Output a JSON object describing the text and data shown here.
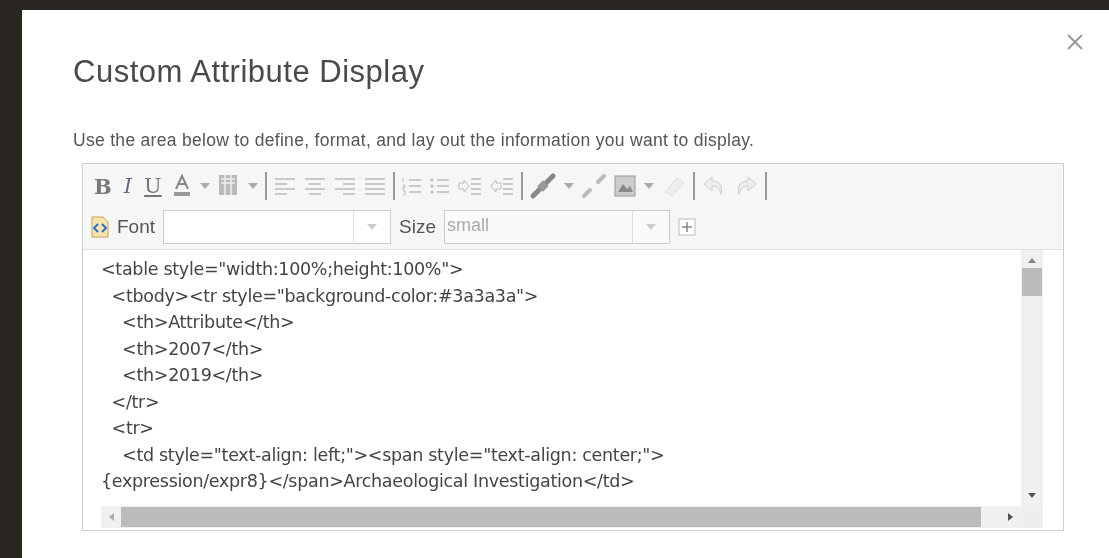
{
  "dialog": {
    "title": "Custom Attribute Display",
    "description": "Use the area below to define, format, and lay out the information you want to display."
  },
  "toolbar": {
    "text_buttons": [
      "B",
      "I",
      "U"
    ]
  },
  "font_row": {
    "font_label": "Font",
    "size_label": "Size",
    "size_value": "small"
  },
  "editor": {
    "lines": [
      "<table style=\"width:100%;height:100%\">",
      "  <tbody><tr style=\"background-color:#3a3a3a\">",
      "    <th>Attribute</th>",
      "    <th>2007</th>",
      "    <th>2019</th>",
      "  </tr>",
      "  <tr>",
      "    <td style=\"text-align: left;\"><span style=\"text-align: center;\">",
      "{expression/expr8}</span>Archaeological Investigation</td>"
    ]
  }
}
